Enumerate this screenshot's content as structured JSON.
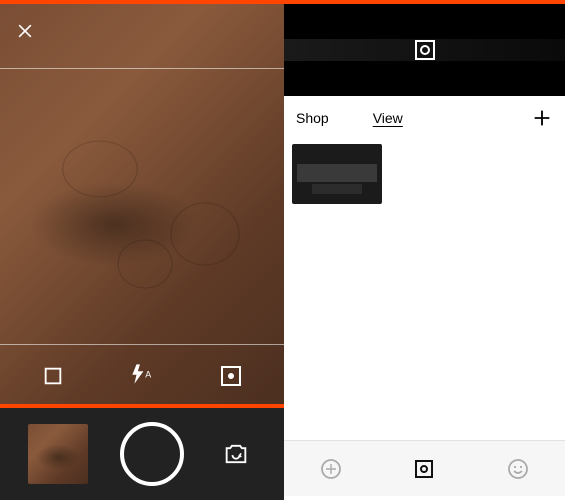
{
  "colors": {
    "accent": "#ff4500"
  },
  "left": {
    "close_aria": "Close",
    "option_icons": {
      "crop": "crop-square-icon",
      "flash": "flash-auto-icon",
      "focus": "center-focus-icon"
    },
    "flash_mode": "A",
    "bottom": {
      "thumb_aria": "Gallery thumbnail",
      "shutter_aria": "Shutter",
      "switch_aria": "Switch camera"
    }
  },
  "right": {
    "mini_aria": "Saved capture preview",
    "tabs": {
      "shop": "Shop",
      "view": "View",
      "active": "view"
    },
    "plus_aria": "Add",
    "gallery": {
      "item_aria": "Laptop keyboard"
    },
    "footbar": {
      "grid_aria": "Grid view",
      "lens_aria": "Lens view",
      "face_aria": "Emoji"
    }
  }
}
